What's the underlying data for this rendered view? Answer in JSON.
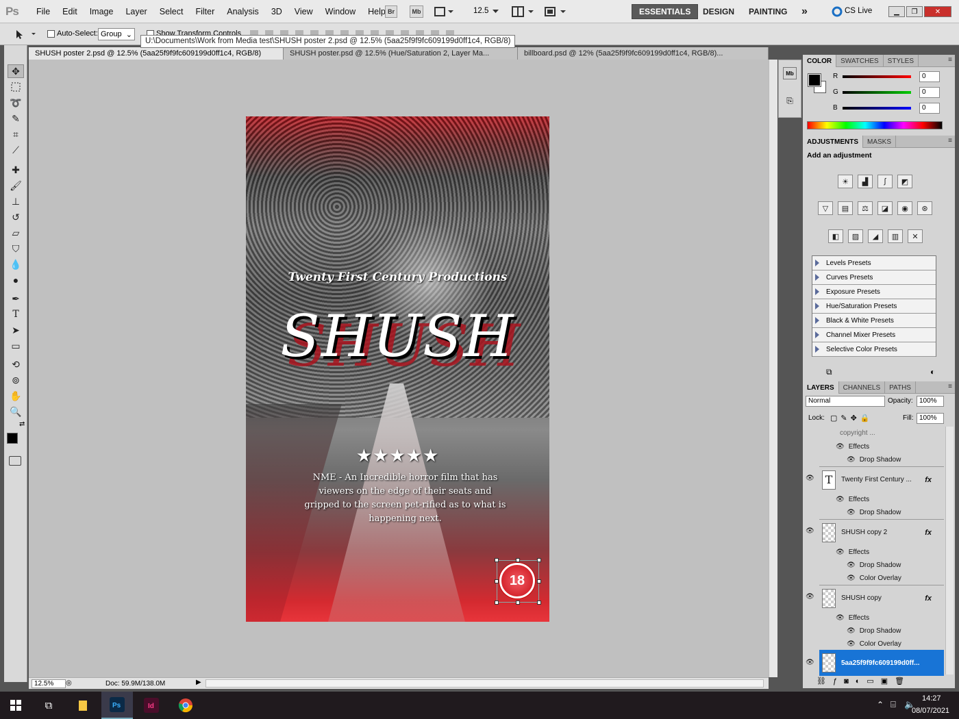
{
  "app": {
    "logo": "Ps",
    "menus": [
      "File",
      "Edit",
      "Image",
      "Layer",
      "Select",
      "Filter",
      "Analysis",
      "3D",
      "View",
      "Window",
      "Help"
    ],
    "bridge": "Br",
    "minibridge": "Mb",
    "zoom": "12.5",
    "workspaces": [
      "ESSENTIALS",
      "DESIGN",
      "PAINTING"
    ],
    "more": "»",
    "cslive": "CS Live"
  },
  "options": {
    "auto_select_label": "Auto-Select:",
    "auto_select_value": "Group",
    "show_transform_label": "Show Transform Controls",
    "tooltip": "U:\\Documents\\Work from Media test\\SHUSH poster 2.psd @ 12.5% (5aa25f9f9fc609199d0ff1c4, RGB/8)"
  },
  "tabs": [
    {
      "label": "SHUSH poster 2.psd @ 12.5% (5aa25f9f9fc609199d0ff1c4, RGB/8)"
    },
    {
      "label": "SHUSH poster.psd @ 12.5% (Hue/Saturation 2, Layer Ma..."
    },
    {
      "label": "billboard.psd @ 12% (5aa25f9f9fc609199d0ff1c4, RGB/8)..."
    }
  ],
  "poster": {
    "production": "Twenty First Century Productions",
    "title": "SHUSH",
    "stars": "★★★★★",
    "review": "NME - An Incredible horror film that has viewers on the edge of their seats and gripped to the screen pet-rified as to what is happening next.",
    "rating": "18"
  },
  "status": {
    "zoom": "12.5%",
    "doc": "Doc: 59.9M/138.0M"
  },
  "color_panel": {
    "tabs": [
      "COLOR",
      "SWATCHES",
      "STYLES"
    ],
    "r_label": "R",
    "g_label": "G",
    "b_label": "B",
    "r": "0",
    "g": "0",
    "b": "0"
  },
  "adjustments": {
    "tabs": [
      "ADJUSTMENTS",
      "MASKS"
    ],
    "heading": "Add an adjustment",
    "presets": [
      "Levels Presets",
      "Curves Presets",
      "Exposure Presets",
      "Hue/Saturation Presets",
      "Black & White Presets",
      "Channel Mixer Presets",
      "Selective Color Presets"
    ]
  },
  "layers_panel": {
    "tabs": [
      "LAYERS",
      "CHANNELS",
      "PATHS"
    ],
    "blend": "Normal",
    "opacity_label": "Opacity:",
    "opacity": "100%",
    "lock_label": "Lock:",
    "fill_label": "Fill:",
    "fill": "100%",
    "top_partial": "copyright ... ",
    "effects": "Effects",
    "drop_shadow": "Drop Shadow",
    "color_overlay": "Color Overlay",
    "layer1": "Twenty First Century ...",
    "layer2": "SHUSH copy 2",
    "layer3": "SHUSH copy",
    "layer4": "5aa25f9f9fc609199d0ff...",
    "fx": "fx"
  },
  "taskbar": {
    "time": "14:27",
    "date": "08/07/2021"
  }
}
